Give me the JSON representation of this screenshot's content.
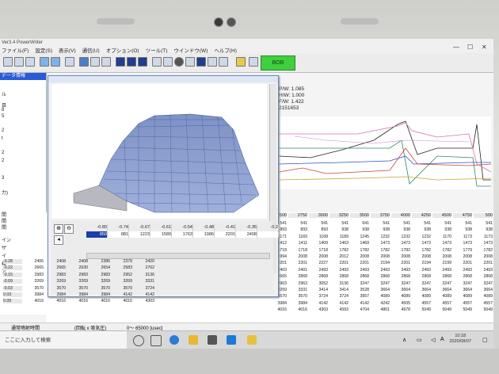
{
  "app": {
    "title": "Ver3.4 PowerWriter",
    "menus": [
      "ファイル(F)",
      "設定(S)",
      "表示(V)",
      "通信(U)",
      "オプション(O)",
      "ツール(T)",
      "ウインドウ(W)",
      "ヘルプ(H)"
    ],
    "status_button": "BOB",
    "status_color": "#3fcf3f"
  },
  "left_panel": {
    "header": "データ情報",
    "items": [
      "ル",
      "目",
      "8",
      "5",
      "2",
      "t",
      "2",
      "2",
      "3",
      "力)",
      "間",
      "間",
      "間",
      "イン",
      "ザ",
      "イ",
      "検",
      "ア"
    ]
  },
  "graph_window": {
    "x_axis": [
      "-0.80",
      "-0.74",
      "-0.67",
      "-0.61",
      "-0.54",
      "-0.48",
      "-0.41",
      "-0.35",
      "-0.2"
    ],
    "values": [
      "",
      "881",
      "1223",
      "1589",
      "1763",
      "1986",
      "2201",
      "2408",
      ""
    ],
    "selected_value": "850"
  },
  "info": {
    "lines": [
      "P/W: 1.085",
      "H/W: 1.000",
      "F/W: 1.422",
      "2151653"
    ]
  },
  "table": {
    "col_headers": [
      "2500",
      "2750",
      "3000",
      "3250",
      "3500",
      "3750",
      "4000",
      "4250",
      "4500",
      "4750",
      "500"
    ],
    "rows": [
      {
        "label": "",
        "cells": [
          "541",
          "541",
          "541",
          "541",
          "641",
          "541",
          "541",
          "541",
          "541",
          "541",
          "541"
        ]
      },
      {
        "label": "",
        "cells": [
          "893",
          "893",
          "893",
          "938",
          "938",
          "938",
          "938",
          "938",
          "938",
          "938",
          "938"
        ]
      },
      {
        "label": "",
        "cells": [
          "1171",
          "1169",
          "1168",
          "1189",
          "1245",
          "1232",
          "1232",
          "1232",
          "1170",
          "1173",
          "1173"
        ]
      },
      {
        "label": "",
        "cells": [
          "1412",
          "1411",
          "1409",
          "1463",
          "1469",
          "1473",
          "1473",
          "1473",
          "1473",
          "1473",
          "1473"
        ]
      },
      {
        "label": "",
        "cells": [
          "1718",
          "1718",
          "1718",
          "1782",
          "1782",
          "1782",
          "1782",
          "1782",
          "1782",
          "1779",
          "1782"
        ]
      },
      {
        "label": "",
        "cells": [
          "1994",
          "2008",
          "2008",
          "2012",
          "2008",
          "2008",
          "2008",
          "2008",
          "2008",
          "2008",
          "2008"
        ]
      },
      {
        "label": "-0.28",
        "cells": [
          "2201",
          "2201",
          "2227",
          "2201",
          "2201",
          "2194",
          "2201",
          "2194",
          "2199",
          "2201",
          "2201"
        ]
      },
      {
        "label": "-0.22",
        "cells": [
          "2403",
          "2401",
          "2493",
          "2493",
          "2493",
          "2493",
          "2493",
          "2493",
          "2493",
          "2493",
          "2493"
        ]
      },
      {
        "label": "-0.15",
        "cells": [
          "2665",
          "2868",
          "2868",
          "2868",
          "2868",
          "2868",
          "2868",
          "2868",
          "2868",
          "2868",
          "2868"
        ]
      },
      {
        "label": "-0.09",
        "cells": [
          "2963",
          "2963",
          "3052",
          "3136",
          "3247",
          "3247",
          "3247",
          "3247",
          "3247",
          "3247",
          "3247"
        ]
      },
      {
        "label": "-0.03",
        "cells": [
          "3269",
          "3331",
          "3414",
          "3414",
          "3528",
          "3664",
          "3664",
          "3664",
          "3664",
          "3664",
          "3664"
        ]
      },
      {
        "label": "0.03",
        "cells": [
          "3570",
          "3570",
          "3724",
          "3724",
          "3957",
          "4089",
          "4089",
          "4089",
          "4089",
          "4089",
          "4089"
        ]
      },
      {
        "label": "0.09",
        "cells": [
          "3984",
          "3984",
          "4142",
          "4142",
          "4142",
          "4242",
          "4505",
          "4557",
          "4557",
          "4557",
          "4557"
        ]
      },
      {
        "label": "0.16",
        "cells": [
          "4016",
          "4016",
          "4303",
          "4593",
          "4704",
          "4801",
          "4978",
          "5049",
          "5049",
          "5049",
          "5049"
        ]
      }
    ]
  },
  "left_rows": [
    {
      "label": "-0.28",
      "cells": [
        "2406",
        "2408",
        "2408",
        "2386",
        "2379",
        "2420"
      ]
    },
    {
      "label": "-0.22",
      "cells": [
        "2665",
        "2665",
        "2630",
        "2654",
        "2583",
        "2762"
      ]
    },
    {
      "label": "-0.15",
      "cells": [
        "2983",
        "2983",
        "2983",
        "2983",
        "2952",
        "3136"
      ]
    },
    {
      "label": "-0.09",
      "cells": [
        "3269",
        "3269",
        "3269",
        "3269",
        "3269",
        "3331"
      ]
    },
    {
      "label": "-0.03",
      "cells": [
        "3570",
        "3570",
        "3570",
        "3570",
        "3570",
        "3724"
      ]
    },
    {
      "label": "0.03",
      "cells": [
        "3984",
        "3984",
        "3984",
        "3984",
        "4142",
        "4142"
      ]
    },
    {
      "label": "0.09",
      "cells": [
        "4016",
        "4016",
        "4016",
        "4016",
        "4016",
        "4303"
      ]
    }
  ],
  "statusbar": {
    "left": "通常噴射時間",
    "right": "(回転 x 吸気圧)",
    "range": "0〜 65000 [usec]"
  },
  "taskbar": {
    "search_placeholder": "ここに入力して検索",
    "time": "10:18",
    "date": "2020/08/07",
    "lang": "A"
  }
}
